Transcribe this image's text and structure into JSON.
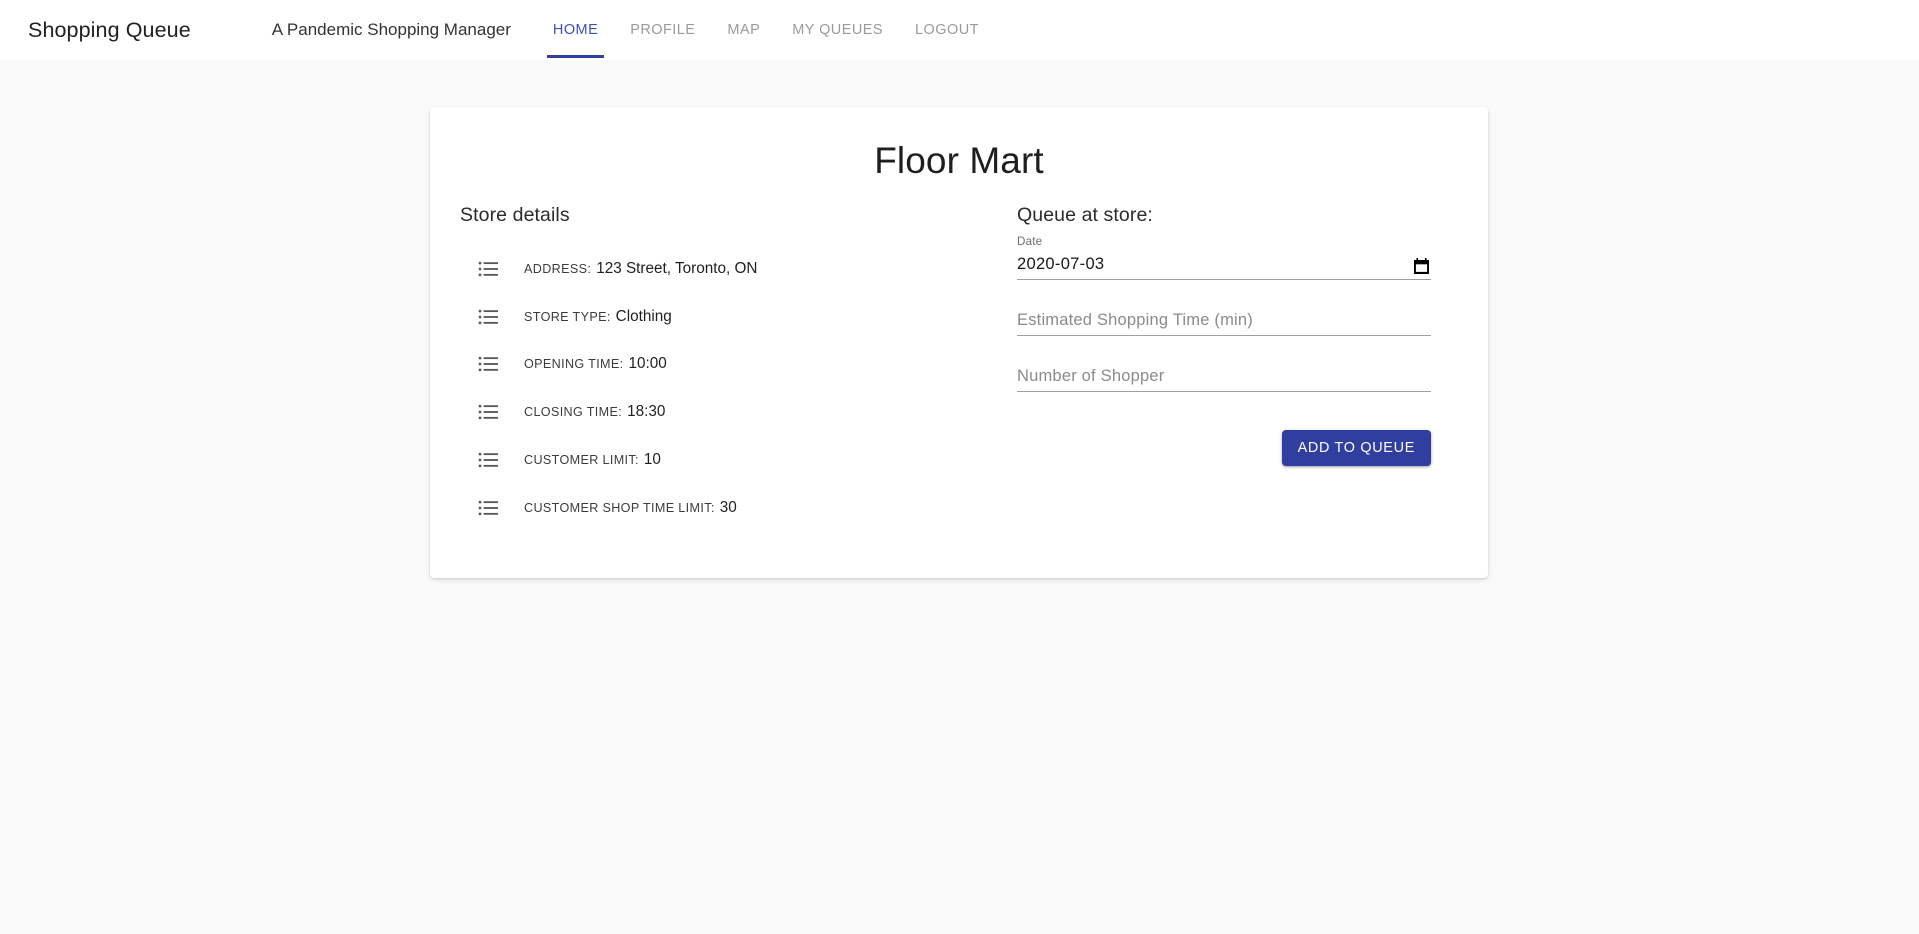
{
  "navbar": {
    "brand": "Shopping Queue",
    "subtitle": "A Pandemic Shopping Manager",
    "active_color": "#3f51b5",
    "indicator_color": "#303f9f",
    "links": [
      {
        "label": "HOME",
        "active": true
      },
      {
        "label": "PROFILE",
        "active": false
      },
      {
        "label": "MAP",
        "active": false
      },
      {
        "label": "MY QUEUES",
        "active": false
      },
      {
        "label": "LOGOUT",
        "active": false
      }
    ]
  },
  "card": {
    "title": "Floor Mart",
    "store_details": {
      "heading": "Store details",
      "icon": "list-icon",
      "rows": [
        {
          "label": "ADDRESS:",
          "value": "123 Street, Toronto, ON"
        },
        {
          "label": "STORE TYPE:",
          "value": "Clothing"
        },
        {
          "label": "OPENING TIME:",
          "value": "10:00"
        },
        {
          "label": "CLOSING TIME:",
          "value": "18:30"
        },
        {
          "label": "CUSTOMER LIMIT:",
          "value": "10"
        },
        {
          "label": "CUSTOMER SHOP TIME LIMIT:",
          "value": "30"
        }
      ]
    },
    "queue_form": {
      "heading": "Queue at store:",
      "date_field": {
        "label": "Date",
        "value": "2020-07-03",
        "icon": "calendar-icon"
      },
      "time_field": {
        "placeholder": "Estimated Shopping Time (min)",
        "value": ""
      },
      "shoppers_field": {
        "placeholder": "Number of Shopper",
        "value": ""
      },
      "submit_label": "ADD TO QUEUE",
      "submit_color": "#303f9f"
    }
  },
  "theme": {
    "page_background": "#fafafa",
    "card_background": "#ffffff",
    "navbar_background": "#ffffff"
  }
}
